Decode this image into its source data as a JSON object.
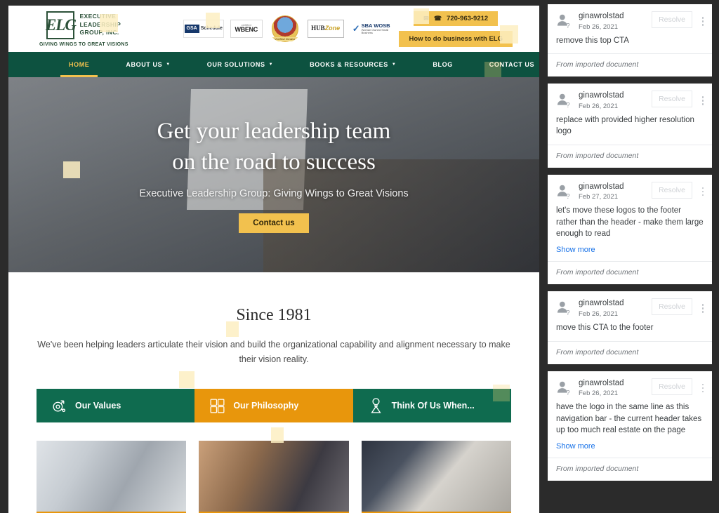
{
  "site": {
    "logo": {
      "mark": "ELG",
      "name_lines": [
        "EXECUTIVE",
        "LEADERSHIP",
        "GROUP, INC."
      ],
      "tagline": "GIVING WINGS TO GREAT VISIONS"
    },
    "badges": [
      {
        "id": "gsa-schedule-badge",
        "primary": "GSA",
        "secondary": "Schedule"
      },
      {
        "id": "wbenc-badge",
        "primary": "WBENC",
        "secondary": "certified"
      },
      {
        "id": "verified-vendor-seal-badge",
        "primary": "Verified Vendor",
        "secondary": ""
      },
      {
        "id": "hubzone-badge",
        "primary": "HUB",
        "secondary": "Zone"
      },
      {
        "id": "sba-wosb-badge",
        "primary": "SBA WOSB",
        "secondary": "Woman Owned Small Business"
      }
    ],
    "contact": {
      "phone": "720-963-9212",
      "email_icon": "envelope-icon",
      "phone_icon": "phone-icon",
      "cta_label": "How to do business with ELG"
    },
    "nav": [
      {
        "label": "HOME",
        "active": true,
        "caret": false
      },
      {
        "label": "ABOUT US",
        "active": false,
        "caret": true
      },
      {
        "label": "OUR SOLUTIONS",
        "active": false,
        "caret": true
      },
      {
        "label": "BOOKS & RESOURCES",
        "active": false,
        "caret": true
      },
      {
        "label": "BLOG",
        "active": false,
        "caret": false
      },
      {
        "label": "CONTACT US",
        "active": false,
        "caret": false
      }
    ],
    "hero": {
      "title_line1": "Get your leadership team",
      "title_line2": "on the road to success",
      "subtitle": "Executive Leadership Group: Giving Wings to Great Visions",
      "button_label": "Contact us"
    },
    "since": {
      "title": "Since 1981",
      "body": "We've been helping leaders articulate their vision and build the organizational capability and alignment necessary to make their vision reality."
    },
    "tiles": [
      {
        "label": "Our Values",
        "icon": "network-node-icon",
        "style": "green"
      },
      {
        "label": "Our Philosophy",
        "icon": "puzzle-icon",
        "style": "orange"
      },
      {
        "label": "Think Of Us When...",
        "icon": "person-bulb-icon",
        "style": "green"
      }
    ],
    "images": [
      {
        "name": "team-collaboration-photo"
      },
      {
        "name": "audience-listening-photo"
      },
      {
        "name": "hands-on-laptop-photo"
      }
    ],
    "colors": {
      "brand_green": "#0d5240",
      "tile_green": "#0f6b4f",
      "accent_yellow": "#f2c14e",
      "accent_orange": "#e8960c",
      "marker_yellow": "#fdeec2"
    }
  },
  "comments": {
    "resolve_label": "Resolve",
    "show_more_label": "Show more",
    "footer_label": "From imported document",
    "items": [
      {
        "author": "ginawrolstad",
        "date": "Feb 26, 2021",
        "text": "remove this top CTA",
        "show_more": false
      },
      {
        "author": "ginawrolstad",
        "date": "Feb 26, 2021",
        "text": "replace with provided higher resolution logo",
        "show_more": false
      },
      {
        "author": "ginawrolstad",
        "date": "Feb 27, 2021",
        "text": "let's move these logos to the footer rather than the header - make them large enough to read",
        "show_more": true
      },
      {
        "author": "ginawrolstad",
        "date": "Feb 26, 2021",
        "text": "move this CTA to the footer",
        "show_more": false
      },
      {
        "author": "ginawrolstad",
        "date": "Feb 26, 2021",
        "text": "have the logo in the same line as this navigation bar - the current header takes up too much real estate on the page",
        "show_more": true
      }
    ]
  }
}
